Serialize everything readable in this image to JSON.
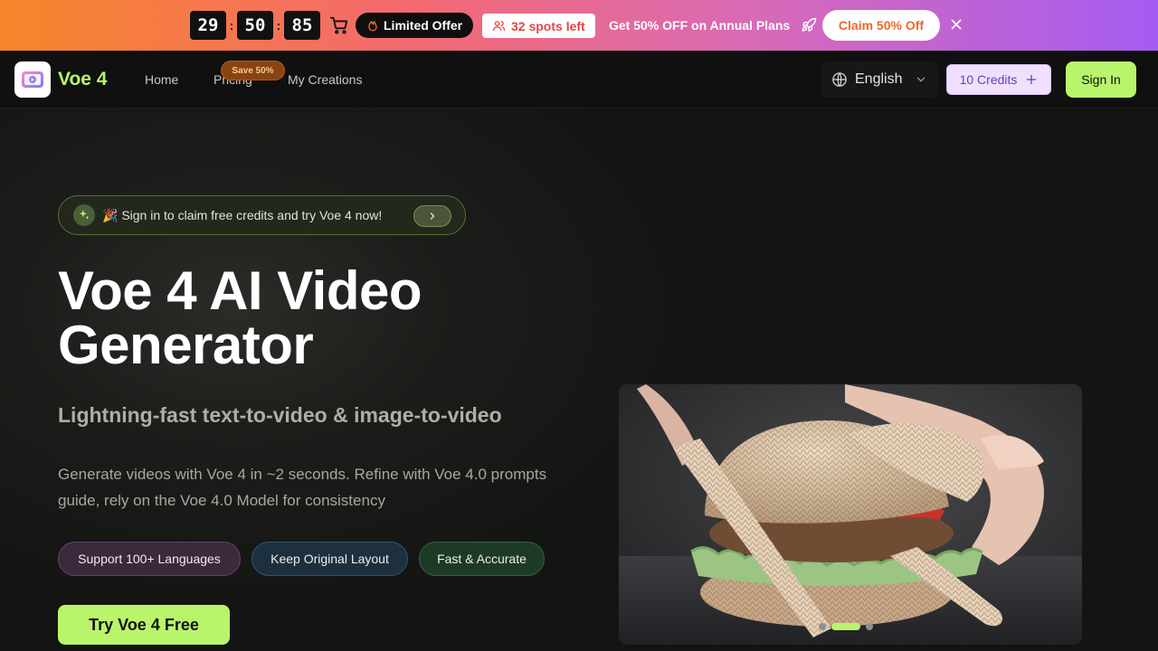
{
  "promo": {
    "timer": {
      "hours": "29",
      "minutes": "50",
      "seconds": "85",
      "separator": ":"
    },
    "limited_label": "Limited Offer",
    "spots_label": "32 spots left",
    "offer_text": "Get 50% OFF on Annual Plans",
    "claim_label": "Claim 50% Off",
    "icons": [
      "cart-icon",
      "flame-icon",
      "users-icon",
      "rocket-icon",
      "close-icon"
    ]
  },
  "nav": {
    "brand": "Voe 4",
    "links": [
      {
        "label": "Home"
      },
      {
        "label": "Pricing",
        "badge": "Save 50%"
      },
      {
        "label": "My Creations"
      }
    ],
    "language": "English",
    "credits_label": "10 Credits",
    "signin_label": "Sign In"
  },
  "hero": {
    "announce_text": "🎉 Sign in to claim free credits and try Voe 4 now!",
    "title_line1": "Voe 4 AI Video",
    "title_line2": "Generator",
    "subtitle": "Lightning-fast text-to-video & image-to-video",
    "description": "Generate videos with Voe 4 in ~2 seconds. Refine with Voe 4.0 prompts guide, rely on the Voe 4.0 Model for consistency",
    "tags": [
      "Support 100+ Languages",
      "Keep Original Layout",
      "Fast & Accurate"
    ],
    "cta_label": "Try Voe 4 Free"
  },
  "carousel": {
    "slide_count": 3,
    "active_index": 1
  },
  "colors": {
    "accent": "#b9f56a",
    "background": "#141513",
    "promo_start": "#f7862a",
    "promo_end": "#a55cf2",
    "credits_bg": "#efe0fe"
  }
}
